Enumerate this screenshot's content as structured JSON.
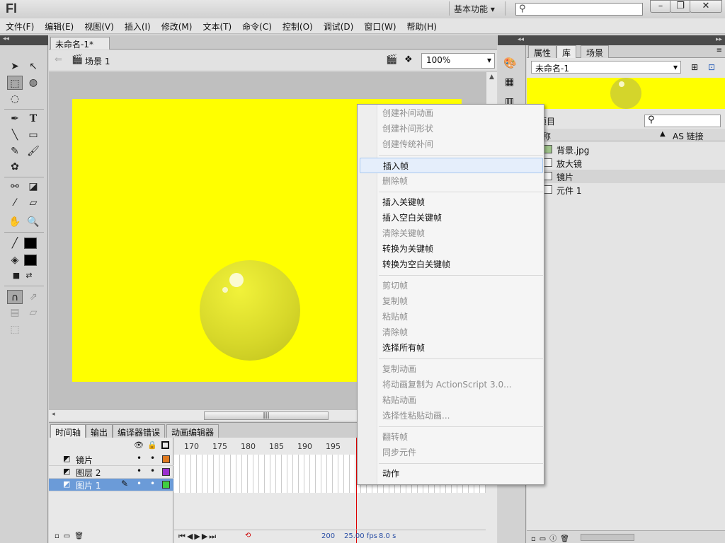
{
  "app": {
    "logo": "Fl",
    "workspace": "基本功能",
    "window_buttons": [
      "–",
      "❐",
      "✕"
    ]
  },
  "menubar": [
    "文件(F)",
    "编辑(E)",
    "视图(V)",
    "插入(I)",
    "修改(M)",
    "文本(T)",
    "命令(C)",
    "控制(O)",
    "调试(D)",
    "窗口(W)",
    "帮助(H)"
  ],
  "document": {
    "tab_label": "未命名-1*",
    "tab_close": "×",
    "scene_label": "场景 1",
    "zoom": "100%",
    "stage_color": "#ffff00"
  },
  "timeline": {
    "tabs": [
      "时间轴",
      "输出",
      "编译器错误",
      "动画编辑器"
    ],
    "frame_numbers": [
      "170",
      "175",
      "180",
      "185",
      "190",
      "195"
    ],
    "layers": [
      {
        "name": "镜片",
        "color": "#e07a1f"
      },
      {
        "name": "图层 2",
        "color": "#9b2fd0"
      },
      {
        "name": "图片 1",
        "color": "#3fcf3f"
      }
    ],
    "status": {
      "frame": "200",
      "fps": "25.00 fps",
      "time": "8.0 s"
    }
  },
  "library": {
    "tabs": [
      "属性",
      "库",
      "场景"
    ],
    "selected_file": "未命名-1",
    "count_label": "项目",
    "header_name": "称",
    "header_link": "AS 链接",
    "items": [
      {
        "name": "背景.jpg",
        "icon": "bitmap-icon"
      },
      {
        "name": "放大镜",
        "icon": "graphic-icon"
      },
      {
        "name": "镜片",
        "icon": "graphic-icon"
      },
      {
        "name": "元件 1",
        "icon": "graphic-icon"
      }
    ]
  },
  "context_menu": [
    {
      "label": "创建补间动画",
      "enabled": false
    },
    {
      "label": "创建补间形状",
      "enabled": false
    },
    {
      "label": "创建传统补间",
      "enabled": false
    },
    {
      "label": "插入帧",
      "enabled": true,
      "hover": true
    },
    {
      "label": "删除帧",
      "enabled": false
    },
    {
      "label": "插入关键帧",
      "enabled": true
    },
    {
      "label": "插入空白关键帧",
      "enabled": true
    },
    {
      "label": "清除关键帧",
      "enabled": false
    },
    {
      "label": "转换为关键帧",
      "enabled": true
    },
    {
      "label": "转换为空白关键帧",
      "enabled": true
    },
    {
      "label": "剪切帧",
      "enabled": false
    },
    {
      "label": "复制帧",
      "enabled": false
    },
    {
      "label": "粘贴帧",
      "enabled": false
    },
    {
      "label": "清除帧",
      "enabled": false
    },
    {
      "label": "选择所有帧",
      "enabled": true
    },
    {
      "label": "复制动画",
      "enabled": false
    },
    {
      "label": "将动画复制为 ActionScript 3.0...",
      "enabled": false
    },
    {
      "label": "粘贴动画",
      "enabled": false
    },
    {
      "label": "选择性粘贴动画...",
      "enabled": false
    },
    {
      "label": "翻转帧",
      "enabled": false
    },
    {
      "label": "同步元件",
      "enabled": false
    },
    {
      "label": "动作",
      "enabled": true
    }
  ]
}
